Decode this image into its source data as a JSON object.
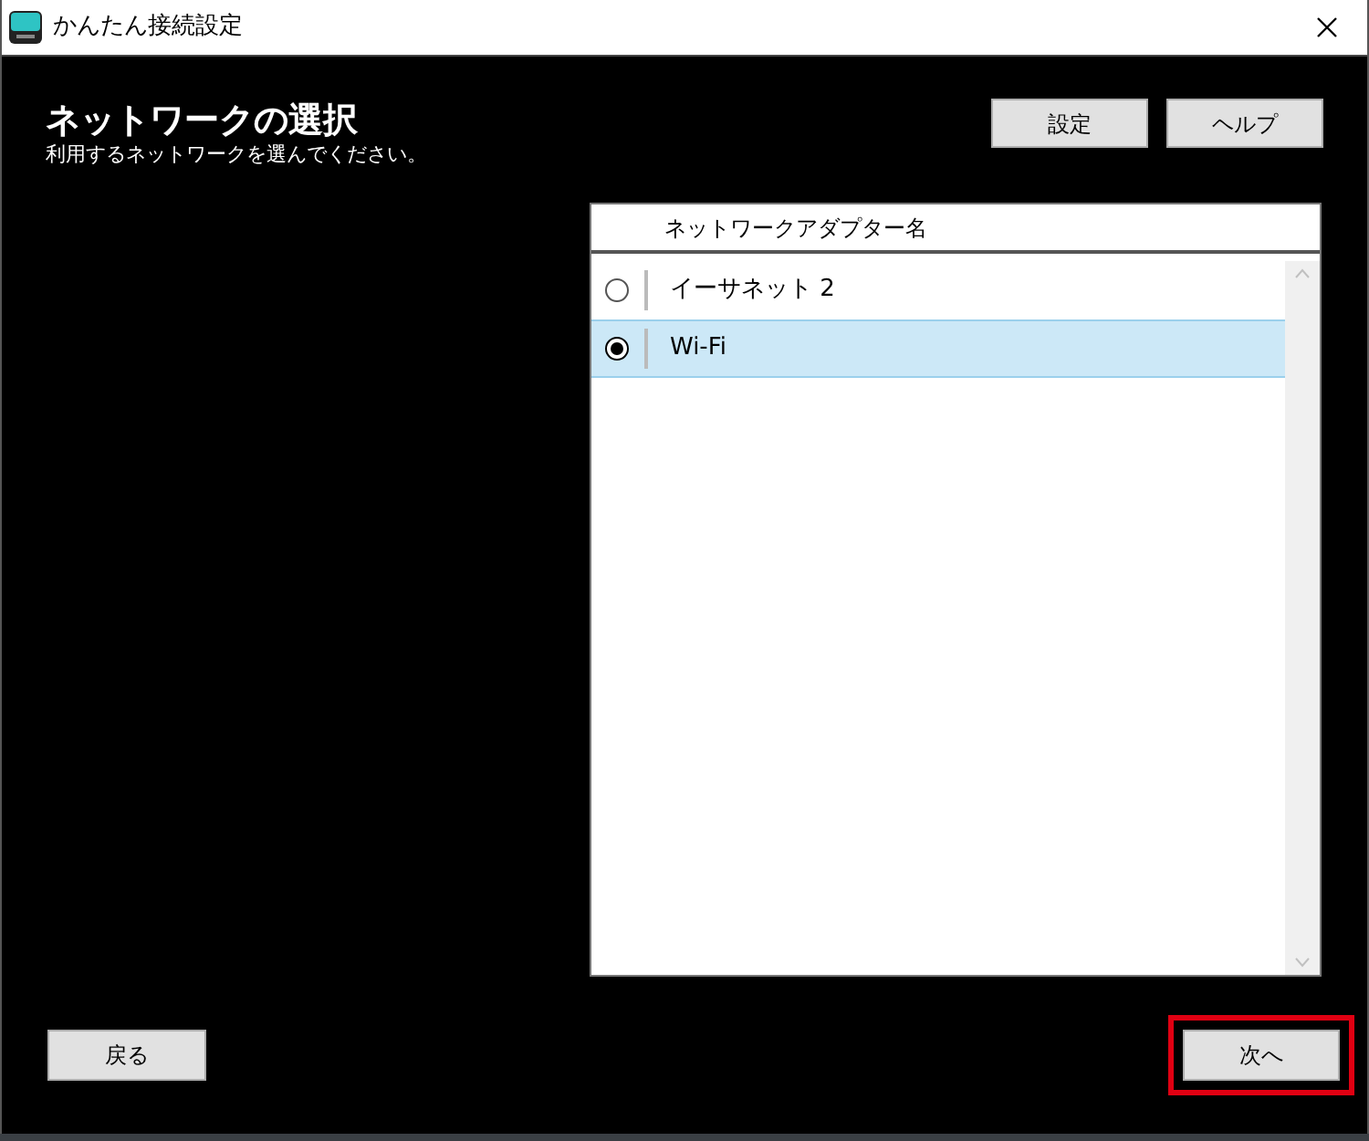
{
  "window": {
    "title": "かんたん接続設定"
  },
  "heading": "ネットワークの選択",
  "subtitle": "利用するネットワークを選んでください。",
  "top_buttons": [
    "設定",
    "ヘルプ"
  ],
  "table": {
    "columns": [
      "ネットワークアダプター名"
    ],
    "rows": [
      {
        "name": "イーサネット 2",
        "selected": false
      },
      {
        "name": "Wi-Fi",
        "selected": true
      }
    ]
  },
  "back_button": "戻る",
  "next_button": {
    "label": "次へ",
    "highlighted": true
  }
}
